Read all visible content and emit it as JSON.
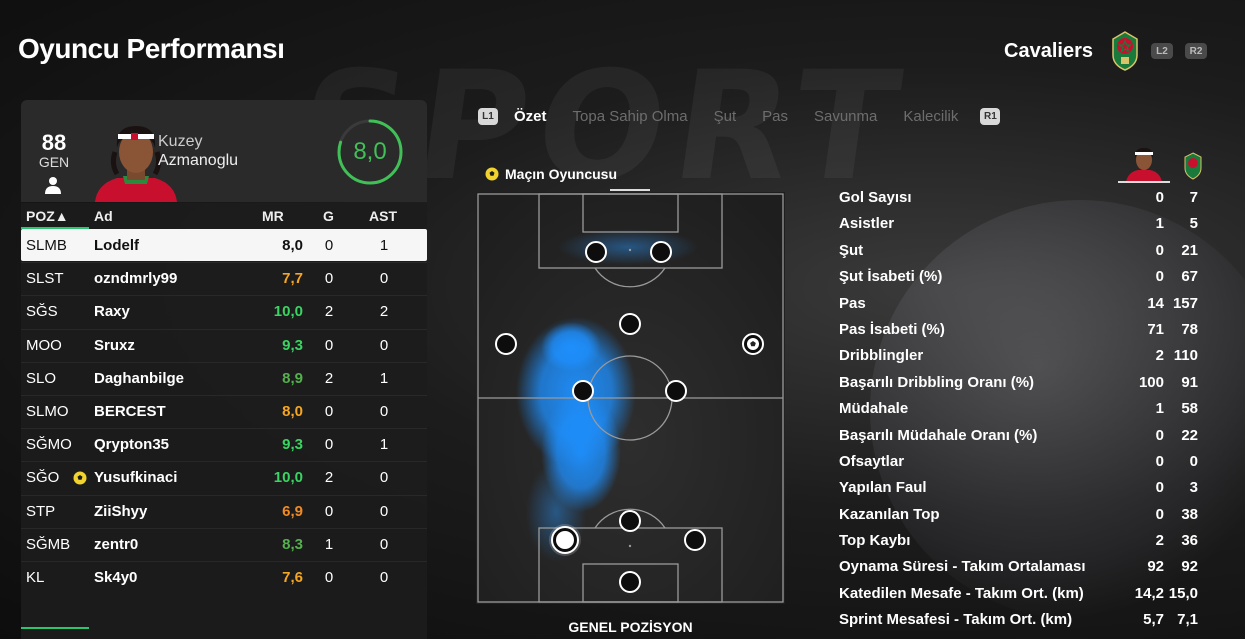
{
  "page": {
    "title": "Oyuncu Performansı"
  },
  "team": {
    "name": "Cavaliers",
    "triggers": [
      "L2",
      "R2"
    ]
  },
  "player_card": {
    "overall": "88",
    "overall_label": "GEN",
    "first_name": "Kuzey",
    "last_name": "Azmanoglu",
    "rating": "8,0",
    "rating_fraction": 0.8
  },
  "table": {
    "headers": {
      "pos": "POZ▲",
      "name": "Ad",
      "mr": "MR",
      "g": "G",
      "ast": "AST"
    },
    "rows": [
      {
        "pos": "SLMB",
        "name": "Lodelf",
        "mr": "8,0",
        "g": "0",
        "ast": "1",
        "selected": true,
        "mr_color": "#111111"
      },
      {
        "pos": "SLST",
        "name": "ozndmrly99",
        "mr": "7,7",
        "g": "0",
        "ast": "0",
        "mr_color": "#f5a623"
      },
      {
        "pos": "SĞS",
        "name": "Raxy",
        "mr": "10,0",
        "g": "2",
        "ast": "2",
        "mr_color": "#3ad463"
      },
      {
        "pos": "MOO",
        "name": "Sruxz",
        "mr": "9,3",
        "g": "0",
        "ast": "0",
        "mr_color": "#3ad463"
      },
      {
        "pos": "SLO",
        "name": "Daghanbilge",
        "mr": "8,9",
        "g": "2",
        "ast": "1",
        "mr_color": "#55b04e"
      },
      {
        "pos": "SLMO",
        "name": "BERCEST",
        "mr": "8,0",
        "g": "0",
        "ast": "0",
        "mr_color": "#f5a623"
      },
      {
        "pos": "SĞMO",
        "name": "Qrypton35",
        "mr": "9,3",
        "g": "0",
        "ast": "1",
        "mr_color": "#3ad463"
      },
      {
        "pos": "SĞO",
        "name": "Yusufkinaci",
        "mr": "10,0",
        "g": "2",
        "ast": "0",
        "mr_color": "#3ad463",
        "motm": true
      },
      {
        "pos": "STP",
        "name": "ZiiShyy",
        "mr": "6,9",
        "g": "0",
        "ast": "0",
        "mr_color": "#f08a24"
      },
      {
        "pos": "SĞMB",
        "name": "zentr0",
        "mr": "8,3",
        "g": "1",
        "ast": "0",
        "mr_color": "#55b04e"
      },
      {
        "pos": "KL",
        "name": "Sk4y0",
        "mr": "7,6",
        "g": "0",
        "ast": "0",
        "mr_color": "#f5a623"
      }
    ]
  },
  "tabs": {
    "left_trigger": "L1",
    "right_trigger": "R1",
    "items": [
      "Özet",
      "Topa Sahip Olma",
      "Şut",
      "Pas",
      "Savunma",
      "Kalecilik"
    ],
    "active_index": 0
  },
  "pitch": {
    "motm_label": "Maçın Oyuncusu",
    "footer": "GENEL POZİSYON"
  },
  "stats": [
    {
      "label": "Gol Sayısı",
      "player": "0",
      "team": "7"
    },
    {
      "label": "Asistler",
      "player": "1",
      "team": "5"
    },
    {
      "label": "Şut",
      "player": "0",
      "team": "21"
    },
    {
      "label": "Şut İsabeti (%)",
      "player": "0",
      "team": "67"
    },
    {
      "label": "Pas",
      "player": "14",
      "team": "157"
    },
    {
      "label": "Pas İsabeti (%)",
      "player": "71",
      "team": "78"
    },
    {
      "label": "Dribblingler",
      "player": "2",
      "team": "110"
    },
    {
      "label": "Başarılı Dribbling Oranı (%)",
      "player": "100",
      "team": "91"
    },
    {
      "label": "Müdahale",
      "player": "1",
      "team": "58"
    },
    {
      "label": "Başarılı Müdahale Oranı (%)",
      "player": "0",
      "team": "22"
    },
    {
      "label": "Ofsaytlar",
      "player": "0",
      "team": "0"
    },
    {
      "label": "Yapılan Faul",
      "player": "0",
      "team": "3"
    },
    {
      "label": "Kazanılan Top",
      "player": "0",
      "team": "38"
    },
    {
      "label": "Top Kaybı",
      "player": "2",
      "team": "36"
    },
    {
      "label": "Oynama Süresi - Takım Ortalaması",
      "player": "92",
      "team": "92"
    },
    {
      "label": "Katedilen Mesafe - Takım Ort. (km)",
      "player": "14,2",
      "team": "15,0"
    },
    {
      "label": "Sprint Mesafesi - Takım Ort. (km)",
      "player": "5,7",
      "team": "7,1"
    }
  ],
  "colors": {
    "accent": "#28c76f",
    "heatmap": "#1e90ff",
    "rating": "#40c057"
  }
}
